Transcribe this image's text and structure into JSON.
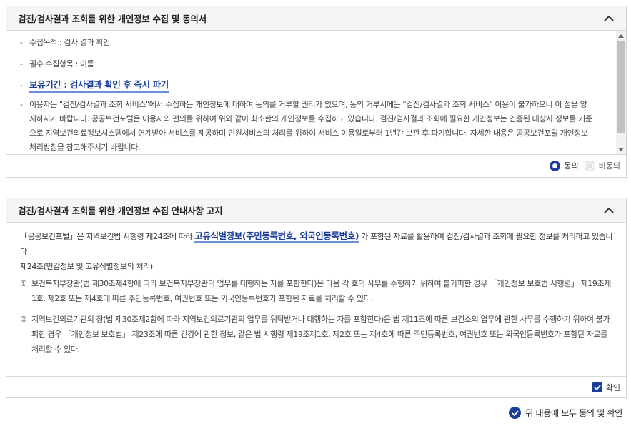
{
  "consent_panel": {
    "title": "검진/검사결과 조회를 위한 개인정보 수집 및 동의서",
    "items": [
      "수집목적 : 검사 결과 확인",
      "필수 수집항목 : 이름",
      "보유기간 : 검사결과 확인 후 즉시 파기",
      "이용자는 \"검진/검사결과 조회 서비스\"에서 수집하는 개인정보에 대하여 동의를 거부할 권리가 있으며, 동의 거부시에는 \"검진/검사결과 조회 서비스\" 이용이 불가하오니 이 점을 양지하시기 바랍니다. 공공보건포털은 이용자의 편의를 위하여 위와 같이 최소한의 개인정보를 수집하고 있습니다. 검진/검사결과 조회에 필요한 개인정보는 인증된 대상자 정보를 기준으로 지역보건의료정보시스템에서 연계받아 서비스를 제공하며 민원서비스의 처리를 위하여 서비스 이용일로부터 1년간 보관 후 파기합니다. 자세한 내용은 공공보건포털 개인정보처리방침을 참고해주시기 바랍니다."
    ],
    "agree_label": "동의",
    "disagree_label": "비동의",
    "selected": "agree"
  },
  "notice_panel": {
    "title": "검진/검사결과 조회를 위한 개인정보 수집 안내사항 고지",
    "intro_before": "「공공보건포털」은 지역보건법 시행령 제24조에 따라 ",
    "intro_highlight": "고유식별정보(주민등록번호, 외국인등록번호)",
    "intro_after": " 가 포함된 자료를 활용하여 검진/검사결과 조회에 필요한 정보를 처리하고 있습니다",
    "article_title": "제24조(민감정보 및 고유식별정보의 처리)",
    "clauses": [
      {
        "num": "①",
        "text": "보건복지부장관(법 제30조제4항에 따라 보건복지부장관의 업무를 대행하는 자를 포함한다)은 다음 각 호의 사무를 수행하기 위하여 불가피한 경우 「개인정보 보호법 시행령」 제19조제1호, 제2호 또는 제4호에 따른 주민등록번호, 여권번호 또는 외국인등록번호가 포함된 자료를 처리할 수 있다."
      },
      {
        "num": "②",
        "text": "지역보건의료기관의 장(법 제30조제2항에 따라 지역보건의료기관의 업무를 위탁받거나 대행하는 자를 포함한다)은 법 제11조에 따른 보건소의 업무에 관한 사무를 수행하기 위하여 불가피한 경우 「개인정보 보호법」 제23조에 따른 건강에 관한 정보, 같은 법 시행령 제19조제1호, 제2호 또는 제4호에 따른 주민등록번호, 여권번호 또는 외국인등록번호가 포함된 자료를 처리할 수 있다."
      }
    ],
    "confirm_label": "확인",
    "confirmed": true
  },
  "agree_all_label": "위 내용에 모두 동의 및 확인",
  "colors": {
    "accent": "#1a3e99",
    "underline": "#6a92d8",
    "header_bg": "#f5f5f5"
  }
}
